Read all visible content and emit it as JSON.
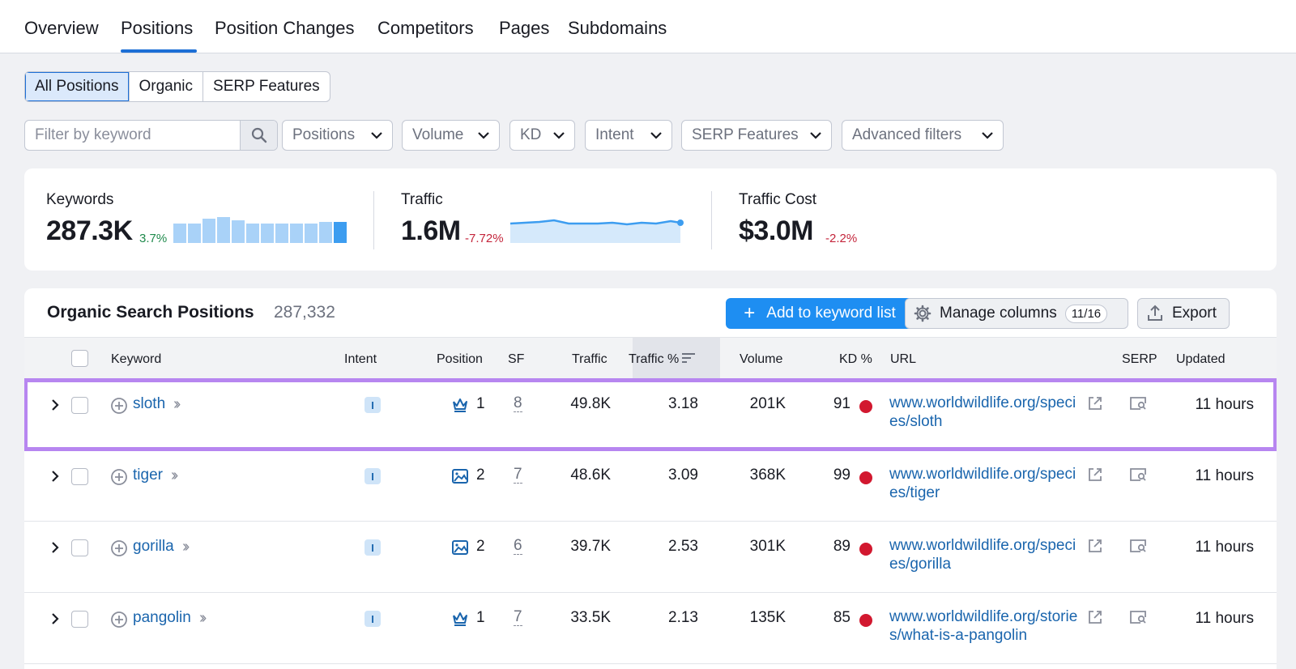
{
  "nav": {
    "tabs": [
      {
        "label": "Overview"
      },
      {
        "label": "Positions"
      },
      {
        "label": "Position Changes"
      },
      {
        "label": "Competitors"
      },
      {
        "label": "Pages"
      },
      {
        "label": "Subdomains"
      }
    ],
    "active_tab": "Positions"
  },
  "segments": [
    "All Positions",
    "Organic",
    "SERP Features"
  ],
  "filters": {
    "search_placeholder": "Filter by keyword",
    "dropdowns": [
      "Positions",
      "Volume",
      "KD",
      "Intent",
      "SERP Features",
      "Advanced filters"
    ]
  },
  "summary": {
    "keywords": {
      "label": "Keywords",
      "value": "287.3K",
      "delta": "3.7%"
    },
    "traffic": {
      "label": "Traffic",
      "value": "1.6M",
      "delta": "-7.72%"
    },
    "traffic_cost": {
      "label": "Traffic Cost",
      "value": "$3.0M",
      "delta": "-2.2%"
    }
  },
  "table": {
    "title": "Organic Search Positions",
    "count": "287,332",
    "add_button": "Add to keyword list",
    "manage_button": "Manage columns",
    "manage_badge": "11/16",
    "export_button": "Export",
    "columns": {
      "keyword": "Keyword",
      "intent": "Intent",
      "position": "Position",
      "sf": "SF",
      "traffic": "Traffic",
      "traffic_pct": "Traffic %",
      "volume": "Volume",
      "kd": "KD %",
      "url": "URL",
      "serp": "SERP",
      "updated": "Updated"
    },
    "rows": [
      {
        "keyword": "sloth",
        "intent": "I",
        "position_icon": "crown-icon",
        "position": "1",
        "sf": "8",
        "traffic": "49.8K",
        "traffic_pct": "3.18",
        "volume": "201K",
        "kd": "91",
        "url": "www.worldwildlife.org/species/sloth",
        "updated": "11 hours"
      },
      {
        "keyword": "tiger",
        "intent": "I",
        "position_icon": "image-icon",
        "position": "2",
        "sf": "7",
        "traffic": "48.6K",
        "traffic_pct": "3.09",
        "volume": "368K",
        "kd": "99",
        "url": "www.worldwildlife.org/species/tiger",
        "updated": "11 hours"
      },
      {
        "keyword": "gorilla",
        "intent": "I",
        "position_icon": "image-icon",
        "position": "2",
        "sf": "6",
        "traffic": "39.7K",
        "traffic_pct": "2.53",
        "volume": "301K",
        "kd": "89",
        "url": "www.worldwildlife.org/species/gorilla",
        "updated": "11 hours"
      },
      {
        "keyword": "pangolin",
        "intent": "I",
        "position_icon": "crown-icon",
        "position": "1",
        "sf": "7",
        "traffic": "33.5K",
        "traffic_pct": "2.13",
        "volume": "135K",
        "kd": "85",
        "url": "www.worldwildlife.org/stories/what-is-a-pangolin",
        "updated": "11 hours"
      }
    ]
  },
  "colors": {
    "accent": "#1e8ef2",
    "highlight": "#b786f0",
    "kd_dot": "#d2182f"
  }
}
